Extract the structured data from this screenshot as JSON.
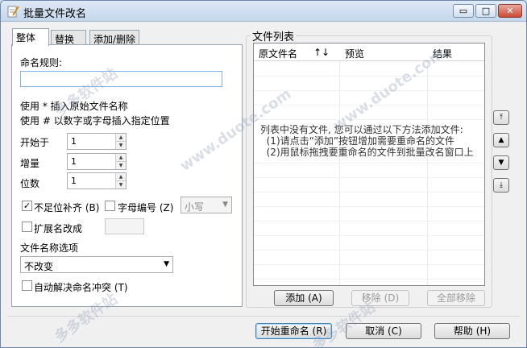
{
  "window": {
    "title": "批量文件改名",
    "controls": {
      "minimize": "▭",
      "maximize": "□",
      "close": "✕"
    }
  },
  "tabs": [
    {
      "label": "整体",
      "active": true
    },
    {
      "label": "替换",
      "active": false
    },
    {
      "label": "添加/删除",
      "active": false
    }
  ],
  "general": {
    "rule_label": "命名规则:",
    "rule_value": "",
    "hint1": "使用 * 插入原始文件名称",
    "hint2": "使用 # 以数字或字母插入指定位置",
    "start_label": "开始于",
    "start_value": "1",
    "step_label": "增量",
    "step_value": "1",
    "digits_label": "位数",
    "digits_value": "1",
    "pad_label": "不足位补齐 (B)",
    "pad_checked": true,
    "pad_mark": "✓",
    "alpha_label": "字母编号 (Z)",
    "alpha_checked": false,
    "case_value": "小写",
    "ext_label": "扩展名改成",
    "ext_checked": false,
    "name_opt_label": "文件名称选项",
    "name_opt_value": "不改变",
    "conflict_label": "自动解决命名冲突 (T)",
    "conflict_checked": false
  },
  "filelist": {
    "group_title": "文件列表",
    "columns": [
      "原文件名",
      "预览",
      "结果"
    ],
    "sort_indicator": "↑↓",
    "empty_message": "列表中没有文件, 您可以通过以下方法添加文件:\n  (1)请点击“添加”按钮增加需要重命名的文件\n  (2)用鼠标拖拽要重命名的文件到批量改名窗口上",
    "add_button": "添加 (A)",
    "remove_button": "移除 (D)",
    "remove_all_button": "全部移除"
  },
  "side_buttons": [
    "⤒",
    "▲",
    "▼",
    "⤓"
  ],
  "footer": {
    "start_button": "开始重命名 (R)",
    "cancel_button": "取消 (C)",
    "help_button": "帮助 (H)"
  },
  "watermark": "多多软件站",
  "watermark2": "www.duote.com"
}
